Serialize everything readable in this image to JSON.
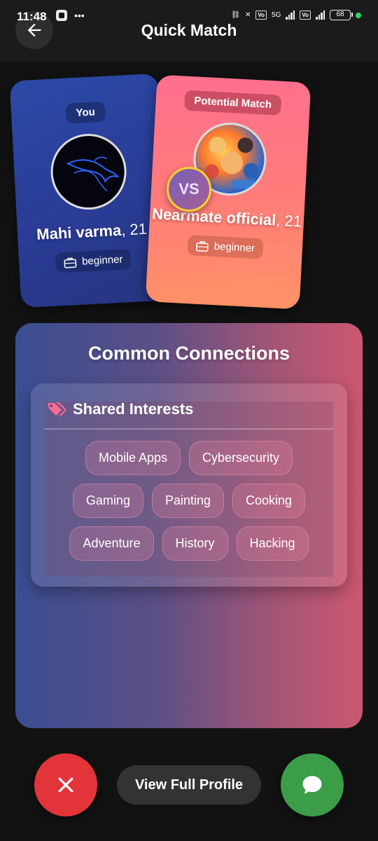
{
  "status_bar": {
    "time": "11:48",
    "battery": "68",
    "network": "5G"
  },
  "header": {
    "title": "Quick Match"
  },
  "you_card": {
    "badge": "You",
    "name": "Mahi varma",
    "age": ", 21",
    "level": "beginner"
  },
  "match_card": {
    "badge": "Potential Match",
    "name": "Nearmate official",
    "age": ", 21",
    "level": "beginner"
  },
  "vs_label": "VS",
  "common": {
    "title": "Common Connections",
    "interests_title": "Shared Interests",
    "interests": [
      "Mobile Apps",
      "Cybersecurity",
      "Gaming",
      "Painting",
      "Cooking",
      "Adventure",
      "History",
      "Hacking"
    ]
  },
  "actions": {
    "view_profile": "View Full Profile"
  },
  "colors": {
    "reject": "#e3343a",
    "chat": "#3b9d47",
    "vs_ring": "#ffcf2e"
  }
}
